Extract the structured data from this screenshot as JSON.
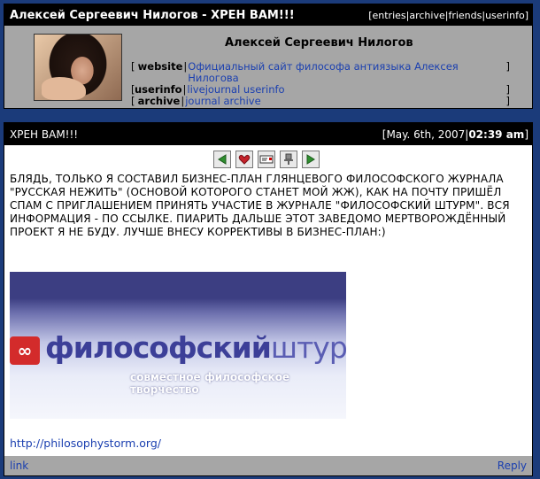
{
  "journal": {
    "title": "Алексей Сергеевич Нилогов - ХРЕН ВАМ!!!",
    "nav": [
      "entries",
      "archive",
      "friends",
      "userinfo"
    ],
    "owner_name": "Алексей Сергеевич Нилогов",
    "info": [
      {
        "key": "website",
        "value": "Официальный сайт философа антиязыка Алексея Нилогова"
      },
      {
        "key": "userinfo",
        "value": "livejournal userinfo"
      },
      {
        "key": "archive",
        "value": "journal archive"
      }
    ]
  },
  "entry": {
    "subject": "ХРЕН ВАМ!!!",
    "date": "May. 6th, 2007",
    "time": "02:39 am",
    "toolbar_icons": [
      "prev-arrow-icon",
      "heart-memory-icon",
      "tell-friend-icon",
      "track-pin-icon",
      "next-arrow-icon"
    ],
    "body": "БЛЯДЬ, ТОЛЬКО Я СОСТАВИЛ БИЗНЕС-ПЛАН ГЛЯНЦЕВОГО ФИЛОСОФСКОГО ЖУРНАЛА \"РУССКАЯ НЕЖИТЬ\" (ОСНОВОЙ КОТОРОГО СТАНЕТ МОЙ ЖЖ), КАК НА ПОЧТУ ПРИШЁЛ СПАМ С ПРИГЛАШЕНИЕМ ПРИНЯТЬ УЧАСТИЕ В ЖУРНАЛЕ \"ФИЛОСОФСКИЙ ШТУРМ\". ВСЯ ИНФОРМАЦИЯ - ПО ССЫЛКЕ. ПИАРИТЬ ДАЛЬШЕ ЭТОТ ЗАВЕДОМО МЕРТВОРОЖДЁННЫЙ ПРОЕКТ Я НЕ БУДУ. ЛУЧШЕ ВНЕСУ КОРРЕКТИВЫ В БИЗНЕС-ПЛАН:)",
    "banner": {
      "logo_symbol": "∞",
      "brand_a": "философский",
      "brand_b": "штурм",
      "tagline": "совместное философское творчество"
    },
    "url": "http://philosophystorm.org/",
    "link_label": "link",
    "reply_label": "Reply"
  },
  "colors": {
    "page_bg": "#1b3b7a",
    "bar_bg": "#000000",
    "panel_bg": "#a6a6a6",
    "link": "#1a3fb0"
  }
}
